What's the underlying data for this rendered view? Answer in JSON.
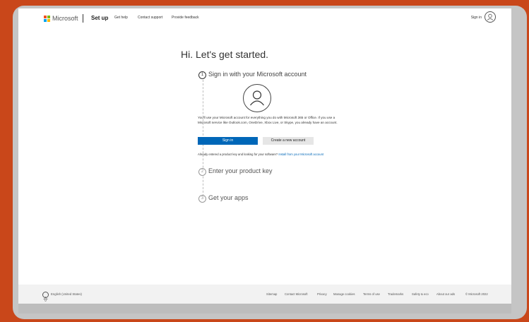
{
  "header": {
    "brand": "Microsoft",
    "logo_colors": [
      "#f25022",
      "#7fba00",
      "#00a4ef",
      "#ffb900"
    ],
    "section_title": "Set up",
    "links": [
      "Get help",
      "Contact support",
      "Provide feedback"
    ],
    "sign_in": "Sign in",
    "account_icon": "person-icon"
  },
  "main": {
    "title": "Hi. Let's get started.",
    "steps": [
      {
        "number": "1",
        "title": "Sign in with your Microsoft account",
        "active": true
      },
      {
        "number": "2",
        "title": "Enter your product key",
        "active": false
      },
      {
        "number": "3",
        "title": "Get your apps",
        "active": false
      }
    ],
    "account_icon": "person-icon",
    "description": "You'll use your Microsoft account for everything you do with Microsoft 365 or Office. If you use a Microsoft service like Outlook.com, OneDrive, Xbox Live, or Skype, you already have an account.",
    "sign_in_button": "Sign in",
    "create_account_button": "Create a new account",
    "product_key_note": "Already entered a product key and looking for your software?",
    "install_link": "Install from your Microsoft account",
    "accent_color": "#0067b8"
  },
  "footer": {
    "language": "English (United States)",
    "globe_icon": "globe-icon",
    "links": [
      "Sitemap",
      "Contact Microsoft",
      "Privacy",
      "Manage cookies",
      "Terms of use",
      "Trademarks",
      "Safety & eco",
      "About our ads",
      "© Microsoft 2022"
    ]
  }
}
